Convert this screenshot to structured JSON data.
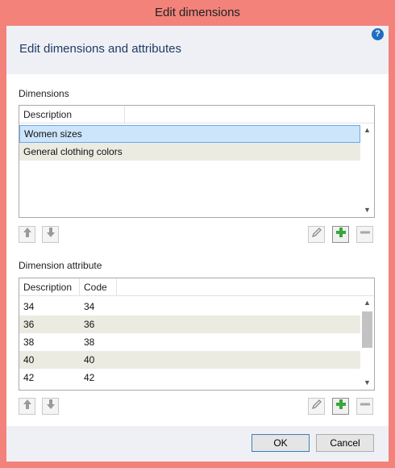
{
  "window": {
    "title": "Edit dimensions"
  },
  "header": {
    "title": "Edit dimensions and attributes",
    "help_icon": "?"
  },
  "dimensions": {
    "label": "Dimensions",
    "columns": [
      "Description"
    ],
    "rows": [
      {
        "description": "Women sizes",
        "selected": true
      },
      {
        "description": "General clothing colors",
        "selected": false
      }
    ]
  },
  "attributes": {
    "label": "Dimension attribute",
    "columns": [
      "Description",
      "Code"
    ],
    "rows": [
      {
        "description": "34",
        "code": "34"
      },
      {
        "description": "36",
        "code": "36"
      },
      {
        "description": "38",
        "code": "38"
      },
      {
        "description": "40",
        "code": "40"
      },
      {
        "description": "42",
        "code": "42"
      }
    ]
  },
  "toolbar_icons": [
    "up-arrow-icon",
    "down-arrow-icon",
    "pencil-icon",
    "plus-icon",
    "minus-icon"
  ],
  "footer": {
    "ok_label": "OK",
    "cancel_label": "Cancel"
  },
  "colors": {
    "title_bar": "#f2827a",
    "header_text": "#1f3c66",
    "selection": "#cde5fb",
    "alt_row": "#ecebe2",
    "add_green": "#3aa63a"
  }
}
